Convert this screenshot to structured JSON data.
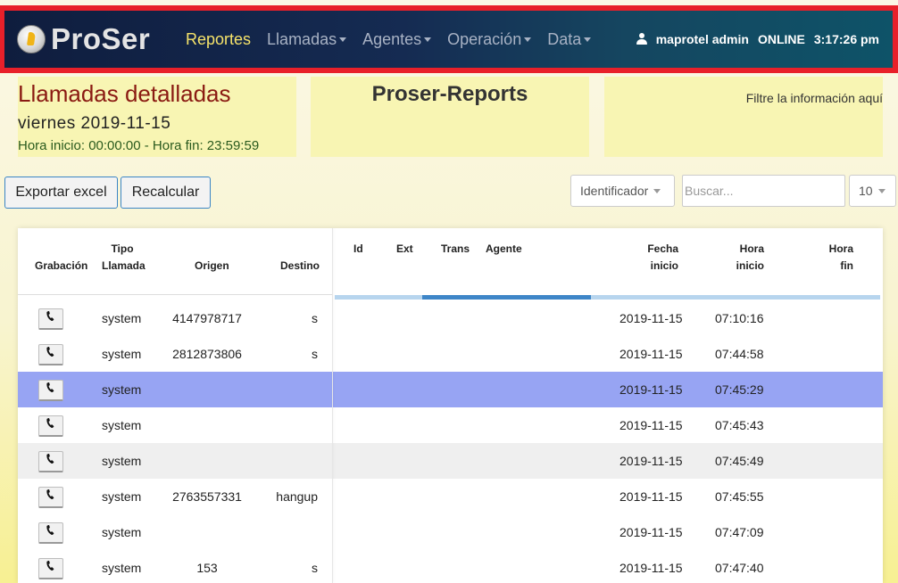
{
  "navbar": {
    "brand": "ProSer",
    "menu": [
      {
        "label": "Reportes",
        "active": true,
        "dropdown": false
      },
      {
        "label": "Llamadas",
        "active": false,
        "dropdown": true
      },
      {
        "label": "Agentes",
        "active": false,
        "dropdown": true
      },
      {
        "label": "Operación",
        "active": false,
        "dropdown": true
      },
      {
        "label": "Data",
        "active": false,
        "dropdown": true
      }
    ],
    "user": "maprotel admin",
    "status": "ONLINE",
    "time": "3:17:26 pm"
  },
  "header": {
    "title": "Llamadas detalladas",
    "date": "viernes 2019-11-15",
    "hours": "Hora inicio: 00:00:00 - Hora fin: 23:59:59",
    "app_title": "Proser-Reports",
    "filter_hint": "Filtre la información aquí"
  },
  "toolbar": {
    "export_label": "Exportar excel",
    "recalc_label": "Recalcular",
    "identifier_select": "Identificador",
    "search_placeholder": "Buscar...",
    "page_size": "10"
  },
  "table": {
    "columns": {
      "grabacion": "Grabación",
      "tipo_llamada": [
        "Tipo",
        "Llamada"
      ],
      "origen": "Origen",
      "destino": "Destino",
      "id": "Id",
      "ext": "Ext",
      "trans": "Trans",
      "agente": "Agente",
      "fecha_inicio": [
        "Fecha",
        "inicio"
      ],
      "hora_inicio": [
        "Hora",
        "inicio"
      ],
      "hora_fin": [
        "Hora",
        "fin"
      ]
    },
    "loading_progress": 0.31,
    "rows": [
      {
        "tipo": "system",
        "origen": "4147978717",
        "destino": "s",
        "fecha": "2019-11-15",
        "hora": "07:10:16",
        "state": "normal"
      },
      {
        "tipo": "system",
        "origen": "2812873806",
        "destino": "s",
        "fecha": "2019-11-15",
        "hora": "07:44:58",
        "state": "normal"
      },
      {
        "tipo": "system",
        "origen": "",
        "destino": "",
        "fecha": "2019-11-15",
        "hora": "07:45:29",
        "state": "selected"
      },
      {
        "tipo": "system",
        "origen": "",
        "destino": "",
        "fecha": "2019-11-15",
        "hora": "07:45:43",
        "state": "normal"
      },
      {
        "tipo": "system",
        "origen": "",
        "destino": "",
        "fecha": "2019-11-15",
        "hora": "07:45:49",
        "state": "striped"
      },
      {
        "tipo": "system",
        "origen": "2763557331",
        "destino": "hangup",
        "fecha": "2019-11-15",
        "hora": "07:45:55",
        "state": "normal"
      },
      {
        "tipo": "system",
        "origen": "",
        "destino": "",
        "fecha": "2019-11-15",
        "hora": "07:47:09",
        "state": "normal"
      },
      {
        "tipo": "system",
        "origen": "153",
        "destino": "s",
        "fecha": "2019-11-15",
        "hora": "07:47:40",
        "state": "normal"
      }
    ]
  }
}
